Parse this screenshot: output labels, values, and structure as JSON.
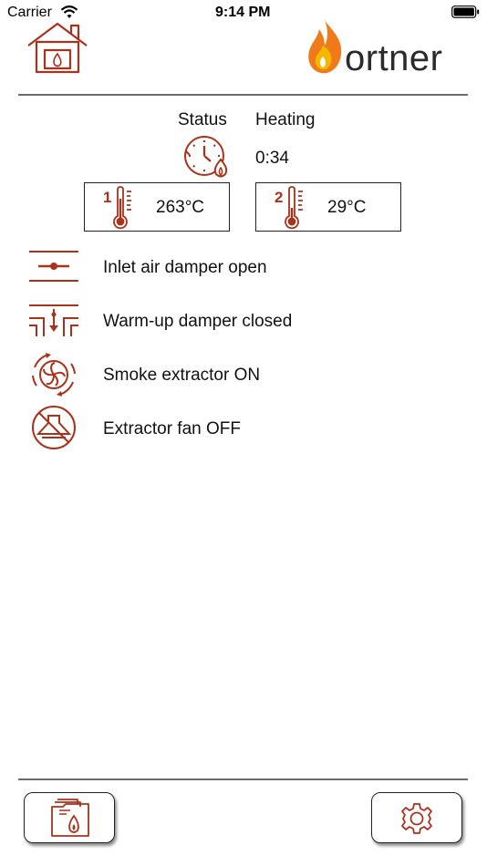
{
  "status_bar": {
    "carrier": "Carrier",
    "time": "9:14 PM"
  },
  "brand": {
    "name": "ortner"
  },
  "status": {
    "label": "Status",
    "mode": "Heating",
    "timer": "0:34"
  },
  "sensors": [
    {
      "index": "1",
      "temperature": "263°C"
    },
    {
      "index": "2",
      "temperature": "29°C"
    }
  ],
  "rows": [
    {
      "label": "Inlet air damper open",
      "icon": "inlet-air-damper-icon"
    },
    {
      "label": "Warm-up damper closed",
      "icon": "warm-up-damper-icon"
    },
    {
      "label": "Smoke extractor ON",
      "icon": "smoke-extractor-icon"
    },
    {
      "label": "Extractor fan OFF",
      "icon": "extractor-fan-off-icon"
    }
  ],
  "colors": {
    "accent": "#a8321c",
    "flame_orange": "#f07a1a",
    "flame_yellow": "#f5b800",
    "text": "#111111"
  }
}
